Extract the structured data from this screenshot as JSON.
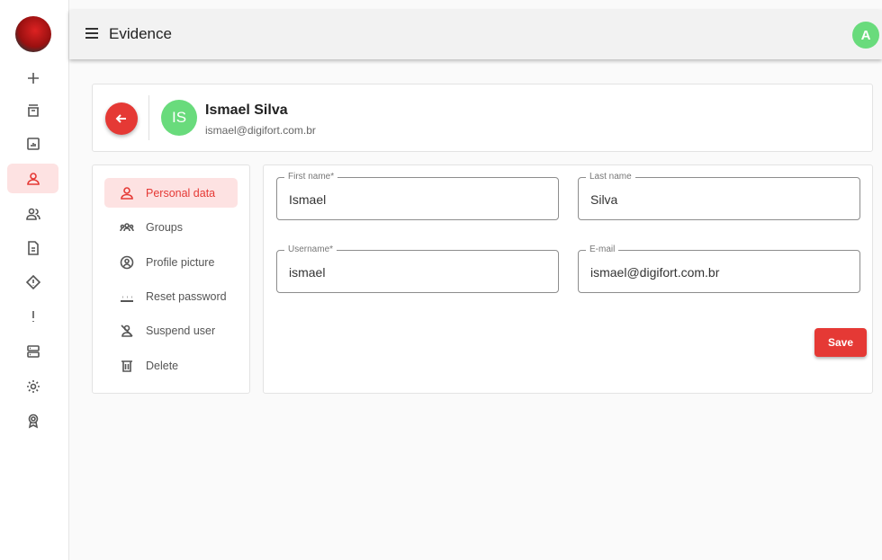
{
  "topbar": {
    "title": "Evidence",
    "avatar_initial": "A"
  },
  "rail": {
    "items": [
      {
        "icon": "add-icon"
      },
      {
        "icon": "archive-icon"
      },
      {
        "icon": "chart-icon"
      },
      {
        "icon": "user-icon",
        "active": true
      },
      {
        "icon": "users-icon"
      },
      {
        "icon": "document-icon"
      },
      {
        "icon": "warning-diamond-icon"
      },
      {
        "icon": "exclamation-icon"
      },
      {
        "icon": "server-icon"
      },
      {
        "icon": "settings-icon"
      },
      {
        "icon": "badge-icon"
      }
    ]
  },
  "user": {
    "initials": "IS",
    "name": "Ismael Silva",
    "email": "ismael@digifort.com.br"
  },
  "menu": {
    "items": [
      {
        "label": "Personal data",
        "icon": "user-icon",
        "active": true
      },
      {
        "label": "Groups",
        "icon": "groups-icon"
      },
      {
        "label": "Profile picture",
        "icon": "profile-picture-icon"
      },
      {
        "label": "Reset password",
        "icon": "password-icon"
      },
      {
        "label": "Suspend user",
        "icon": "suspend-user-icon"
      },
      {
        "label": "Delete",
        "icon": "trash-icon"
      }
    ]
  },
  "form": {
    "first_name": {
      "label": "First name*",
      "value": "Ismael"
    },
    "last_name": {
      "label": "Last name",
      "value": "Silva"
    },
    "username": {
      "label": "Username*",
      "value": "ismael"
    },
    "email": {
      "label": "E-mail",
      "value": "ismael@digifort.com.br"
    },
    "save_label": "Save"
  },
  "colors": {
    "accent": "#e53935",
    "avatar": "#69db7c",
    "active_bg": "#fde2e2"
  }
}
